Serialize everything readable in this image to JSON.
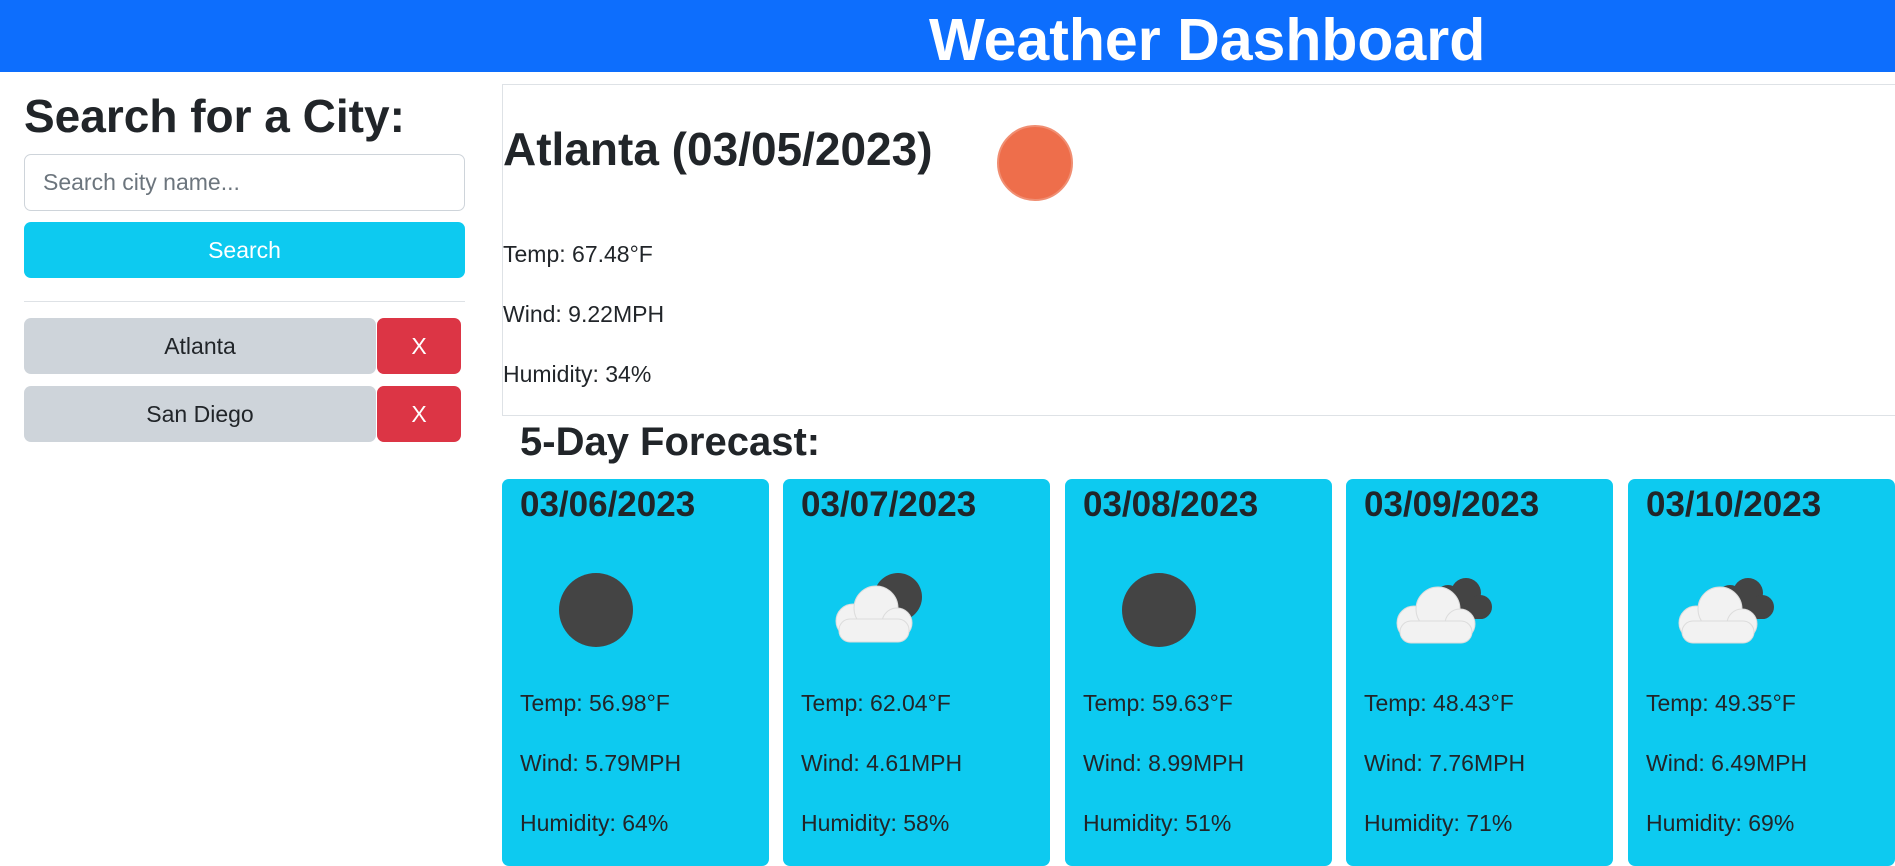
{
  "header": {
    "title": "Weather Dashboard"
  },
  "search": {
    "heading": "Search for a City:",
    "placeholder": "Search city name...",
    "button_label": "Search"
  },
  "history": [
    {
      "city": "Atlanta",
      "remove_label": "X"
    },
    {
      "city": "San Diego",
      "remove_label": "X"
    }
  ],
  "current": {
    "title": "Atlanta (03/05/2023)",
    "icon": "sun-icon",
    "temp": "Temp: 67.48°F",
    "wind": "Wind: 9.22MPH",
    "humidity": "Humidity: 34%"
  },
  "forecast": {
    "heading": "5-Day Forecast:",
    "days": [
      {
        "date": "03/06/2023",
        "icon": "moon-icon",
        "temp": "Temp: 56.98°F",
        "wind": "Wind: 5.79MPH",
        "humidity": "Humidity: 64%"
      },
      {
        "date": "03/07/2023",
        "icon": "cloud-moon-icon",
        "temp": "Temp: 62.04°F",
        "wind": "Wind: 4.61MPH",
        "humidity": "Humidity: 58%"
      },
      {
        "date": "03/08/2023",
        "icon": "moon-icon",
        "temp": "Temp: 59.63°F",
        "wind": "Wind: 8.99MPH",
        "humidity": "Humidity: 51%"
      },
      {
        "date": "03/09/2023",
        "icon": "broken-clouds-icon",
        "temp": "Temp: 48.43°F",
        "wind": "Wind: 7.76MPH",
        "humidity": "Humidity: 71%"
      },
      {
        "date": "03/10/2023",
        "icon": "broken-clouds-icon",
        "temp": "Temp: 49.35°F",
        "wind": "Wind: 6.49MPH",
        "humidity": "Humidity: 69%"
      }
    ]
  },
  "colors": {
    "header": "#0d6efd",
    "accent": "#0dcaf0",
    "danger": "#dc3545",
    "secondary": "#ced4da",
    "sun": "#ee6e4b",
    "moon": "#444444"
  }
}
